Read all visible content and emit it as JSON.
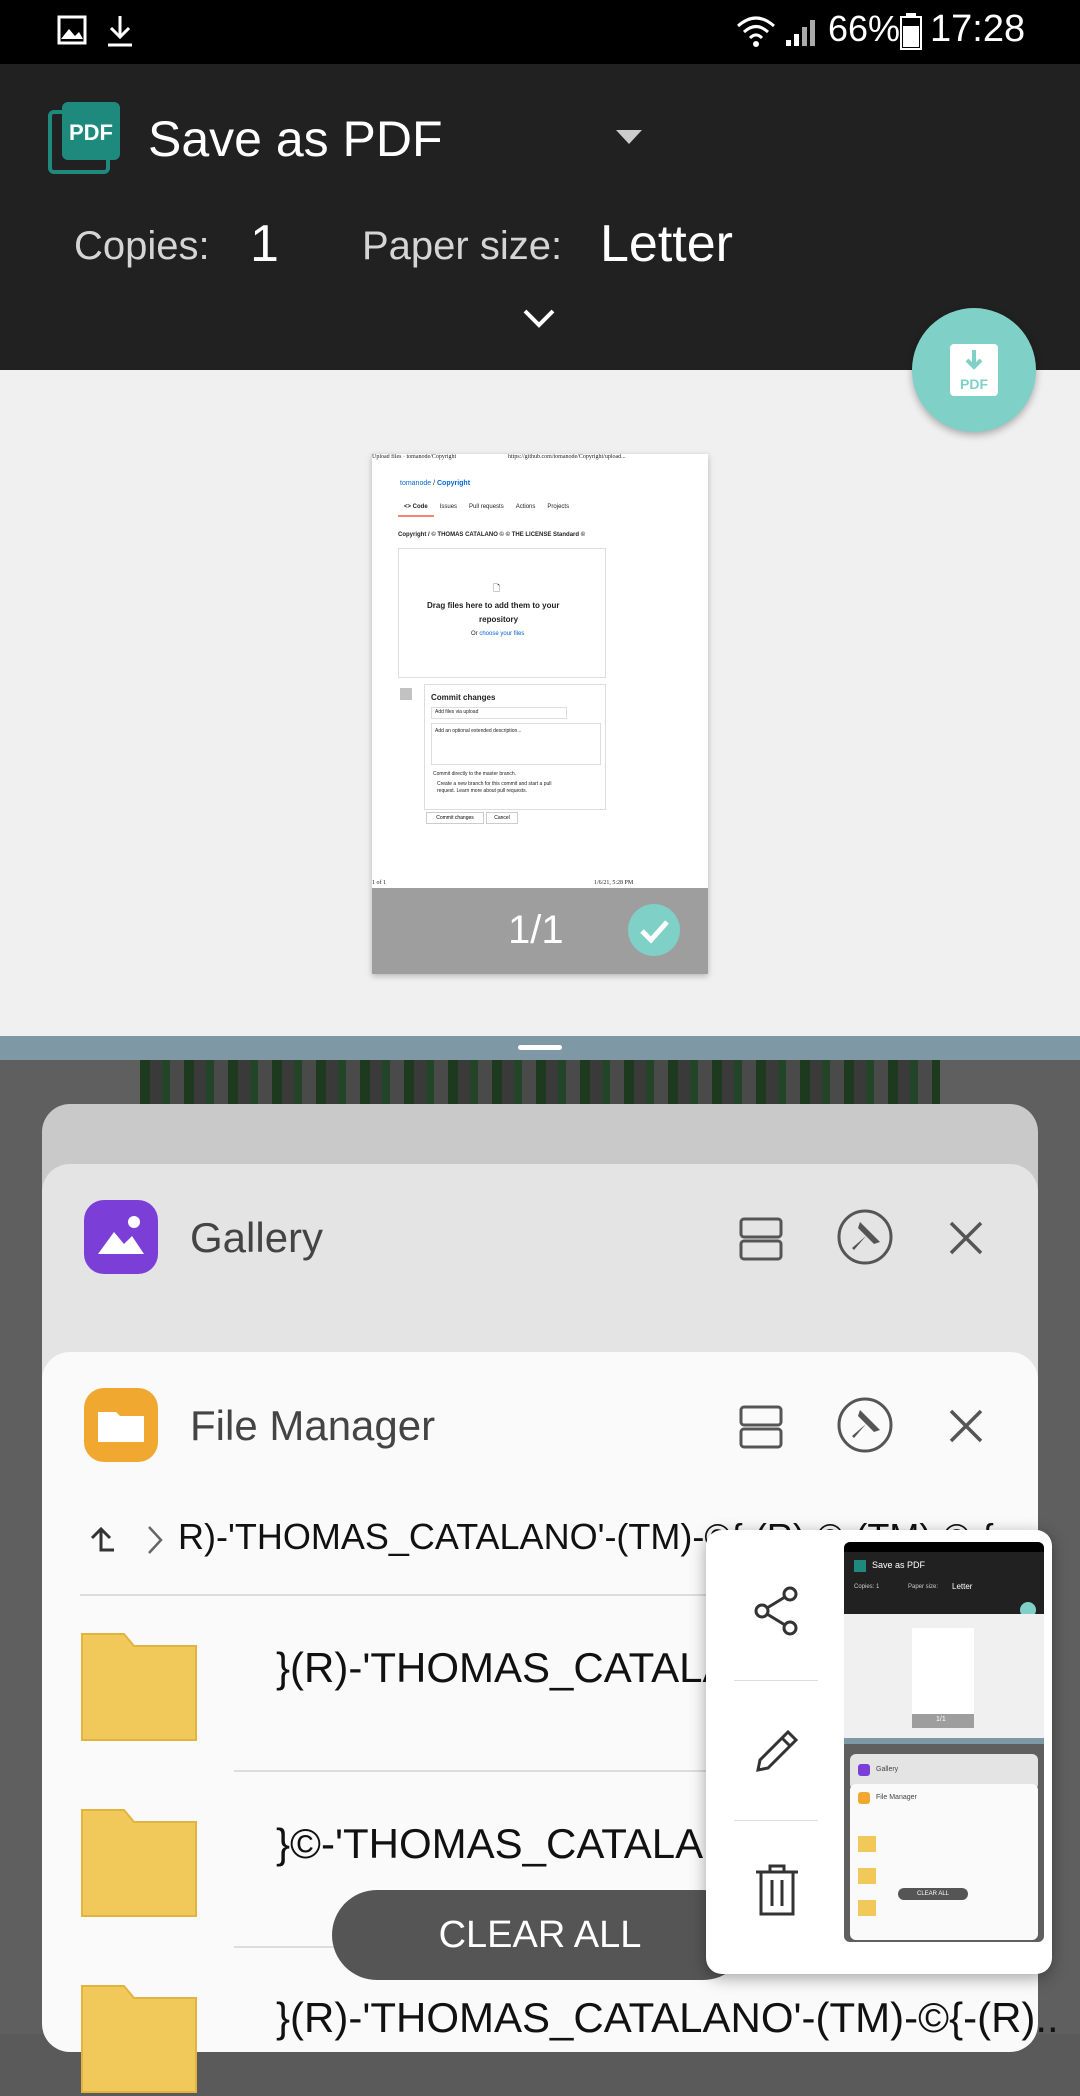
{
  "status_bar": {
    "battery": "66%",
    "time": "17:28",
    "icons": [
      "gallery-icon",
      "download-icon",
      "wifi-icon",
      "signal-icon",
      "battery-icon"
    ]
  },
  "print_header": {
    "printer_name": "Save as PDF",
    "copies_label": "Copies:",
    "copies_value": "1",
    "paper_label": "Paper size:",
    "paper_value": "Letter",
    "fab_label": "PDF"
  },
  "preview": {
    "header_left": "Upload files · tomanode/Copyright",
    "header_right": "https://github.com/tomanode/Copyright/upload...",
    "repo_owner": "tomanode",
    "repo_sep": " / ",
    "repo_name": "Copyright",
    "tabs": [
      "<> Code",
      "Issues",
      "Pull requests",
      "Actions",
      "Projects"
    ],
    "path": "Copyright / © THOMAS CATALANO © © THE LICENSE Standard ©",
    "drop_line1": "Drag files here to add them to your",
    "drop_line2": "repository",
    "drop_or": "Or ",
    "drop_choose": "choose your files",
    "commit_title": "Commit changes",
    "commit_input": "Add files via upload",
    "commit_desc": "Add an optional extended description...",
    "commit_opt1": "Commit directly to the  master  branch.",
    "commit_opt2a": "Create a new branch for this commit and start a pull",
    "commit_opt2b": "request. Learn more about pull requests.",
    "btn_commit": "Commit changes",
    "btn_cancel": "Cancel",
    "footer_left": "1 of 1",
    "footer_right": "1/6/21, 5:28 PM",
    "page_count": "1/1"
  },
  "recents": {
    "gallery_title": "Gallery",
    "files_title": "File Manager",
    "breadcrumb": "R)-'THOMAS_CATALANO'-(TM)-©{-(R)-©-(TM)-©-{-",
    "folders": [
      "}(R)-'THOMAS_CATALANO'",
      "}©-'THOMAS_CATALANO'",
      "}(R)-'THOMAS_CATALANO'-(TM)-©{-(R).."
    ],
    "clear_all": "CLEAR ALL"
  },
  "screenshot_popup": {
    "actions": [
      "share-icon",
      "edit-icon",
      "delete-icon"
    ],
    "mini_title": "Save as PDF",
    "mini_copies": "Copies:  1",
    "mini_paper": "Paper size:",
    "mini_letter": "Letter",
    "mini_count": "1/1",
    "mini_gallery": "Gallery",
    "mini_files": "File Manager",
    "mini_clear": "CLEAR ALL"
  },
  "colors": {
    "header_bg": "#212121",
    "accent_teal": "#7fd0c6",
    "pdf_icon": "#1e8a7e",
    "folder": "#f0c95a",
    "gallery_icon": "#7b3fd8",
    "files_icon": "#f0a830"
  }
}
